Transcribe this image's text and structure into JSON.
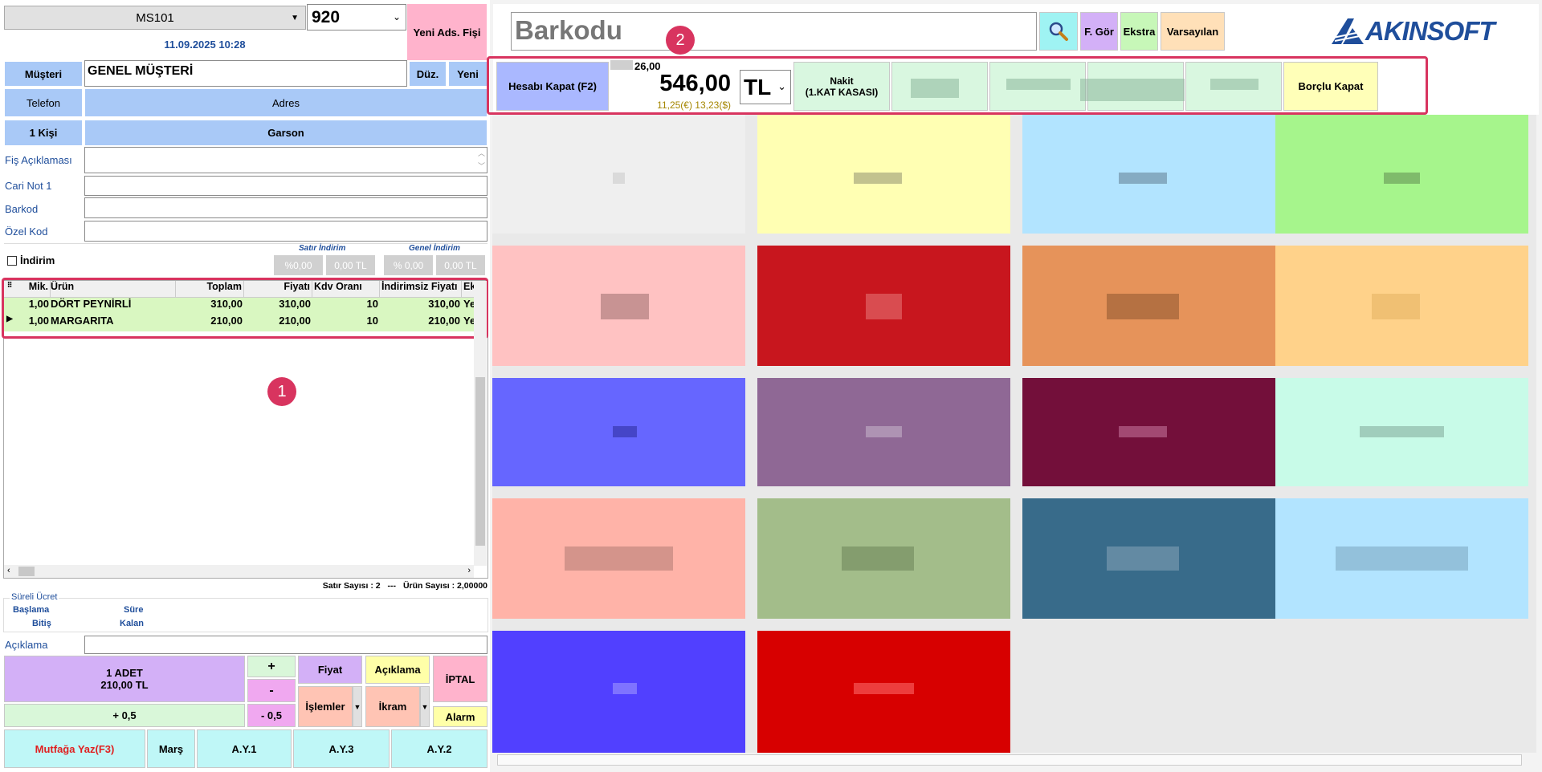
{
  "left": {
    "table_select": "MS101",
    "table_number": "920",
    "new_receipt": "Yeni Ads. Fişi",
    "datetime": "11.09.2025 10:28",
    "customer_label": "Müşteri",
    "customer_value": "GENEL MÜŞTERİ",
    "edit_btn": "Düz.",
    "new_btn": "Yeni",
    "phone_label": "Telefon",
    "address_label": "Adres",
    "persons_label": "1 Kişi",
    "waiter_label": "Garson",
    "fields": {
      "receipt_note": "Fiş Açıklaması",
      "cari_note": "Cari Not 1",
      "barcode": "Barkod",
      "special_code": "Özel Kod"
    },
    "discount": {
      "label": "İndirim",
      "line_discount": "Satır İndirim",
      "general_discount": "Genel İndirim",
      "line_pct": "%0,00",
      "line_amt": "0,00 TL",
      "gen_pct": "% 0,00",
      "gen_amt": "0,00 TL"
    },
    "grid": {
      "columns": [
        "Mik.",
        "Ürün",
        "Toplam",
        "Fiyatı",
        "Kdv Oranı",
        "İndirimsiz Fiyatı",
        "Ek"
      ],
      "rows": [
        {
          "qty": "1,00",
          "product": "DÖRT PEYNİRLİ",
          "total": "310,00",
          "price": "310,00",
          "vat": "10",
          "undiscounted": "310,00",
          "ek": "Ye"
        },
        {
          "qty": "1,00",
          "product": "MARGARITA",
          "total": "210,00",
          "price": "210,00",
          "vat": "10",
          "undiscounted": "210,00",
          "ek": "Ye"
        }
      ]
    },
    "badge1": "1",
    "status": {
      "row_count": "Satır Sayısı : 2",
      "sep": "---",
      "product_count": "Ürün Sayısı : 2,00000"
    },
    "timed": {
      "title": "Süreli Ücret",
      "start": "Başlama",
      "end": "Bitiş",
      "duration": "Süre",
      "remaining": "Kalan"
    },
    "note_label": "Açıklama",
    "qty_display_line1": "1 ADET",
    "qty_display_line2": "210,00 TL",
    "plus": "+",
    "minus": "-",
    "plus_half": "+ 0,5",
    "minus_half": "- 0,5",
    "price_btn": "Fiyat",
    "note_btn": "Açıklama",
    "cancel_btn": "İPTAL",
    "ops_btn": "İşlemler",
    "treat_btn": "İkram",
    "alarm_btn": "Alarm",
    "kitchen_btn": "Mutfağa Yaz(F3)",
    "mars_btn": "Marş",
    "ay1": "A.Y.1",
    "ay3": "A.Y.3",
    "ay2": "A.Y.2"
  },
  "right": {
    "barcode_placeholder": "Barkodu",
    "fgor": "F. Gör",
    "extra": "Ekstra",
    "defaults": "Varsayılan",
    "logo": "AKINSOFT",
    "badge2": "2",
    "close_account": "Hesabı Kapat (F2)",
    "small_amount": "26,00",
    "total": "546,00",
    "foreign": "11,25(€) 13,23($)",
    "currency": "TL",
    "cash_line1": "Nakit",
    "cash_line2": "(1.KAT KASASI)",
    "credit_close": "Borçlu Kapat"
  },
  "colors": {
    "accent_pink": "#ffb3cc",
    "highlight_red": "#d8345f",
    "row_green": "#d9f7c1"
  }
}
